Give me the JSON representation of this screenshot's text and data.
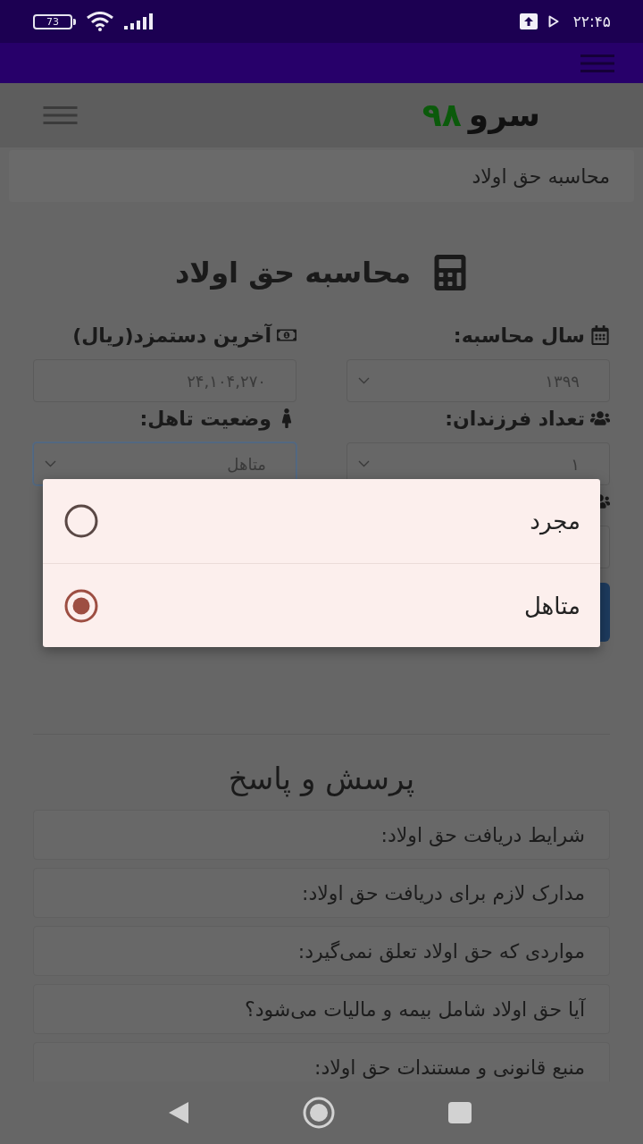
{
  "status_bar": {
    "battery": "73",
    "time": "۲۲:۴۵"
  },
  "header": {
    "logo": {
      "text": "سرو",
      "number": "۹۸"
    }
  },
  "breadcrumb": {
    "current": "محاسبه حق اولاد"
  },
  "calculator": {
    "title": "محاسبه حق اولاد",
    "fields": [
      {
        "kind": "select",
        "label": "سال محاسبه:",
        "value": "۱۳۹۹",
        "focused": false
      },
      {
        "kind": "input",
        "label": "آخرین دستمزد(ریال)",
        "value": "۲۴,۱۰۴,۲۷۰",
        "focused": false
      },
      {
        "kind": "select",
        "label": "تعداد فرزندان:",
        "value": "۱",
        "focused": false
      },
      {
        "kind": "select",
        "label": "وضعیت تاهل:",
        "value": "متاهل",
        "focused": true
      }
    ]
  },
  "faq": {
    "title": "پرسش و پاسخ",
    "items": [
      "شرایط دریافت حق اولاد:",
      "مدارک لازم برای دریافت حق اولاد:",
      "مواردی که حق اولاد تعلق نمی‌گیرد:",
      "آیا حق اولاد شامل بیمه و مالیات می‌شود؟",
      "منبع قانونی و مستندات حق اولاد:"
    ]
  },
  "dialog": {
    "options": [
      {
        "label": "مجرد",
        "selected": false
      },
      {
        "label": "متاهل",
        "selected": true
      }
    ]
  }
}
